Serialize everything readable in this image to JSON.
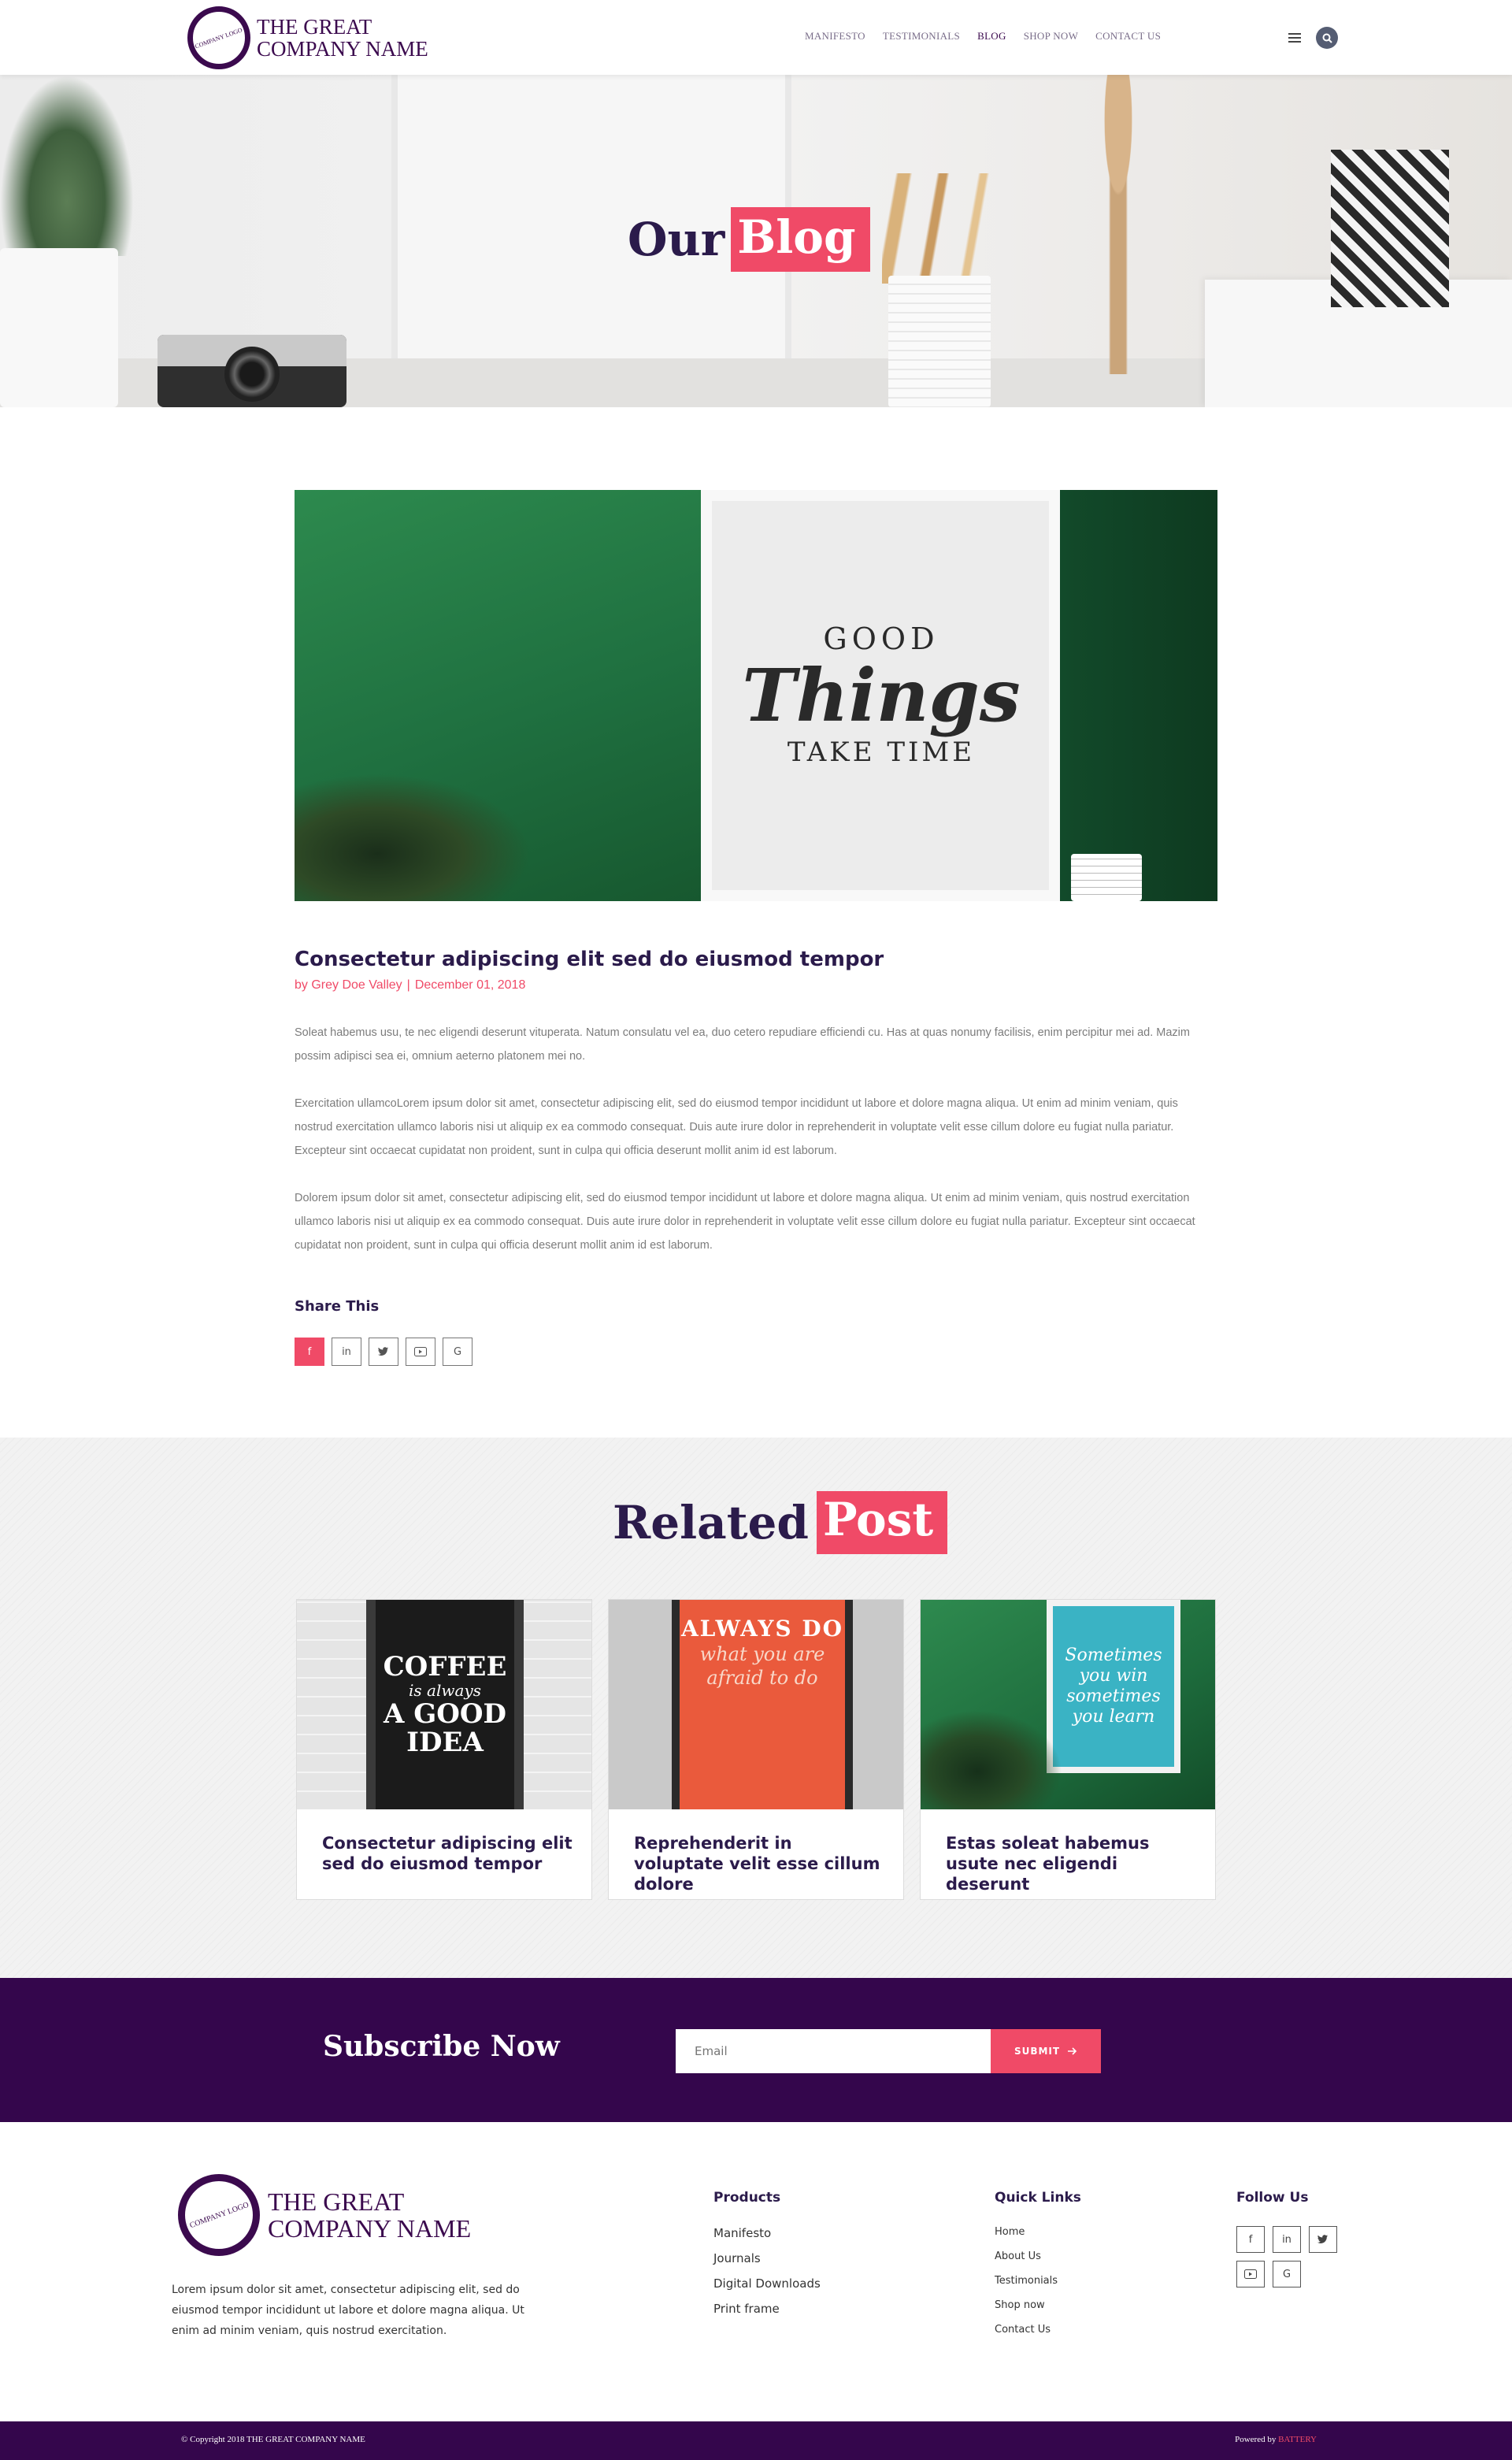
{
  "header": {
    "logo_badge": "COMPANY LOGO",
    "logo_line1": "THE GREAT",
    "logo_line2": "COMPANY NAME",
    "nav": [
      "MANIFESTO",
      "TESTIMONIALS",
      "BLOG",
      "SHOP NOW",
      "CONTACT US"
    ],
    "active_nav": "BLOG"
  },
  "hero": {
    "title_plain": "Our",
    "title_highlight": "Blog"
  },
  "post": {
    "image_text": {
      "line1": "GOOD",
      "line2": "Things",
      "line3": "TAKE TIME"
    },
    "title": "Consectetur adipiscing elit sed do eiusmod tempor",
    "author": "by Grey Doe Valley",
    "date": "December 01, 2018",
    "paragraphs": [
      "Soleat habemus usu, te nec eligendi deserunt vituperata. Natum consulatu vel ea, duo cetero repudiare efficiendi cu. Has at quas nonumy facilisis, enim percipitur mei ad. Mazim possim adipisci sea ei, omnium aeterno platonem mei no.",
      "Exercitation ullamcoLorem ipsum dolor sit amet, consectetur adipiscing elit, sed do eiusmod tempor incididunt ut labore et dolore magna aliqua. Ut enim ad minim veniam, quis nostrud exercitation ullamco laboris nisi ut aliquip ex ea commodo consequat. Duis aute irure dolor in reprehenderit in voluptate velit esse cillum dolore eu fugiat nulla pariatur. Excepteur sint occaecat cupidatat non proident, sunt in culpa qui officia deserunt mollit anim id est laborum.",
      "Dolorem ipsum dolor sit amet, consectetur adipiscing elit, sed do eiusmod tempor incididunt ut labore et dolore magna aliqua. Ut enim ad minim veniam, quis nostrud exercitation ullamco laboris nisi ut aliquip ex ea commodo consequat. Duis aute irure dolor in reprehenderit in voluptate velit esse cillum dolore eu fugiat nulla pariatur. Excepteur sint occaecat cupidatat non proident, sunt in culpa qui officia deserunt mollit anim id est laborum."
    ],
    "share_title": "Share This",
    "share_icons": [
      "f",
      "in",
      "t",
      "yt",
      "G"
    ]
  },
  "related": {
    "title_plain": "Related",
    "title_highlight": "Post",
    "cards": [
      {
        "title": "Consectetur adipiscing elit sed do eiusmod tempor",
        "poster": {
          "big1": "COFFEE",
          "small1": "is always",
          "big2": "A GOOD IDEA"
        }
      },
      {
        "title": "Reprehenderit in voluptate velit esse cillum dolore",
        "poster": {
          "big1": "ALWAYS DO",
          "small1": "what you are afraid to do"
        }
      },
      {
        "title": "Estas soleat habemus usute nec eligendi deserunt",
        "poster": {
          "text": "Sometimes you win sometimes you learn"
        }
      }
    ]
  },
  "subscribe": {
    "title": "Subscribe Now",
    "placeholder": "Email",
    "button": "SUBMIT"
  },
  "footer": {
    "about": "Lorem ipsum dolor sit amet, consectetur adipiscing elit, sed do eiusmod tempor incididunt ut labore et dolore magna aliqua. Ut enim ad minim veniam, quis nostrud exercitation.",
    "products_title": "Products",
    "products": [
      "Manifesto",
      "Journals",
      "Digital Downloads",
      "Print frame"
    ],
    "quick_title": "Quick Links",
    "quick_links": [
      "Home",
      "About Us",
      "Testimonials",
      "Shop now",
      "Contact Us"
    ],
    "follow_title": "Follow Us",
    "follow_icons": [
      "f",
      "in",
      "t",
      "yt",
      "G"
    ],
    "copyright": "© Copyright 2018 THE GREAT COMPANY NAME",
    "powered_by": "Powered by",
    "powered_brand": "BATTERY"
  },
  "colors": {
    "accent": "#f04a67",
    "brand_purple": "#34064c",
    "heading": "#2b1b4b"
  }
}
